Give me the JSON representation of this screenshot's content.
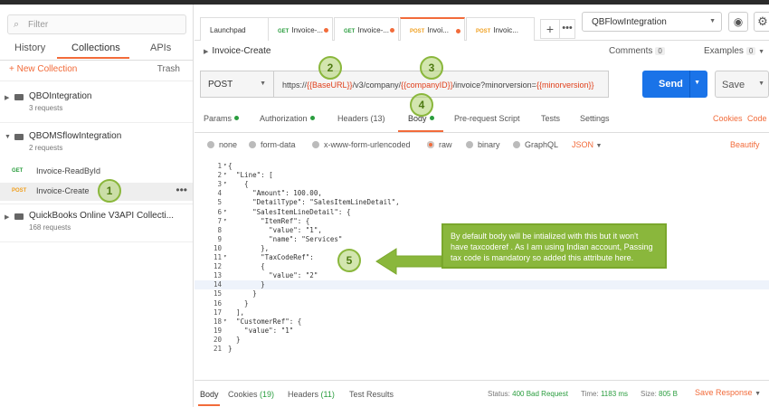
{
  "sidebar": {
    "filter_placeholder": "Filter",
    "tabs": [
      "History",
      "Collections",
      "APIs"
    ],
    "new_collection": "+ New Collection",
    "trash": "Trash",
    "collections": [
      {
        "name": "QBOIntegration",
        "count": "3 requests"
      },
      {
        "name": "QBOMSflowIntegration",
        "count": "2 requests"
      },
      {
        "name": "QuickBooks Online V3API Collecti...",
        "count": "168 requests"
      }
    ],
    "requests": [
      {
        "method": "GET",
        "name": "Invoice-ReadById"
      },
      {
        "method": "POST",
        "name": "Invoice-Create"
      }
    ]
  },
  "tabs": [
    {
      "method": "",
      "label": "Launchpad"
    },
    {
      "method": "GET",
      "label": "Invoice-..."
    },
    {
      "method": "GET",
      "label": "Invoice-..."
    },
    {
      "method": "POST",
      "label": "Invoi..."
    },
    {
      "method": "POST",
      "label": "Invoic..."
    }
  ],
  "environment": "QBFlowIntegration",
  "request": {
    "name": "Invoice-Create",
    "comments_label": "Comments",
    "comments_count": "0",
    "examples_label": "Examples",
    "examples_count": "0",
    "method": "POST",
    "url_prefix": "https://",
    "url_var1": "{{BaseURL}}",
    "url_mid": "/v3/company/",
    "url_var2": "{{companyID}}",
    "url_mid2": "/invoice?minorversion=",
    "url_var3": "{{minorversion}}",
    "send": "Send",
    "save": "Save"
  },
  "subtabs": {
    "params": "Params",
    "authorization": "Authorization",
    "headers": "Headers (13)",
    "body": "Body",
    "prerequest": "Pre-request Script",
    "tests": "Tests",
    "settings": "Settings",
    "cookies": "Cookies",
    "code": "Code"
  },
  "body_options": [
    "none",
    "form-data",
    "x-www-form-urlencoded",
    "raw",
    "binary",
    "GraphQL"
  ],
  "body_format": "JSON",
  "beautify": "Beautify",
  "code_lines": [
    "{",
    "  \"Line\": [",
    "    {",
    "      \"Amount\": 100.00,",
    "      \"DetailType\": \"SalesItemLineDetail\",",
    "      \"SalesItemLineDetail\": {",
    "        \"ItemRef\": {",
    "          \"value\": \"1\",",
    "          \"name\": \"Services\"",
    "        },",
    "        \"TaxCodeRef\":",
    "        {",
    "          \"value\": \"2\"",
    "        }",
    "      }",
    "    }",
    "  ],",
    "  \"CustomerRef\": {",
    "    \"value\": \"1\"",
    "  }",
    "}"
  ],
  "annotations": {
    "marker1": "1",
    "marker2": "2",
    "marker3": "3",
    "marker4": "4",
    "marker5": "5",
    "callout": "By default body will be intialized with this but it won't have taxcoderef . As I am using Indian account, Passing tax code is mandatory so added this attribute here."
  },
  "response": {
    "body": "Body",
    "cookies": "Cookies",
    "cookies_count": "(19)",
    "headers": "Headers",
    "headers_count": "(11)",
    "test_results": "Test Results",
    "status_label": "Status:",
    "status": "400 Bad Request",
    "time_label": "Time:",
    "time": "1183 ms",
    "size_label": "Size:",
    "size": "805 B",
    "save_response": "Save Response"
  },
  "colors": {
    "accent": "#f26b3a",
    "send": "#1a73e8",
    "get": "#2a9d3e",
    "post": "#f0a020",
    "annotation": "#8ab73c"
  }
}
